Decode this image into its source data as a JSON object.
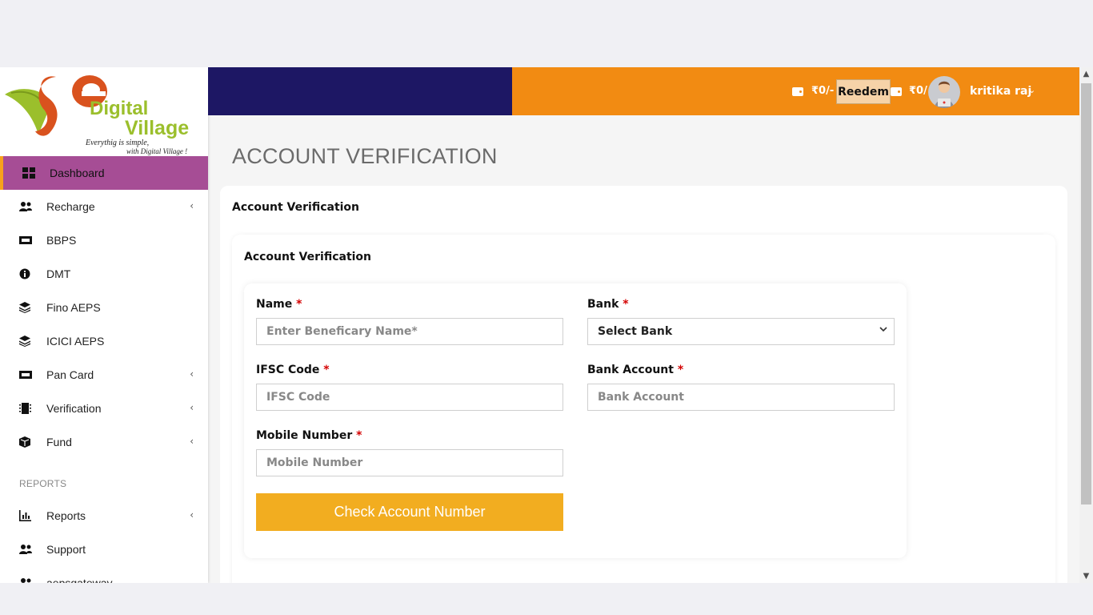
{
  "brand": {
    "logo_word_1": "Digital",
    "logo_word_2": "Village",
    "tagline_1": "Everythig is simple,",
    "tagline_2": "with Digital Village !",
    "colors": {
      "green": "#9bbf2c",
      "orange_red": "#d9521e"
    }
  },
  "sidebar": {
    "items": [
      {
        "label": "Dashboard",
        "icon": "dashboard-grid-icon",
        "active": true
      },
      {
        "label": "Recharge",
        "icon": "users-icon",
        "has_submenu": true
      },
      {
        "label": "BBPS",
        "icon": "ticket-icon"
      },
      {
        "label": "DMT",
        "icon": "info-circle-icon"
      },
      {
        "label": "Fino AEPS",
        "icon": "layers-icon"
      },
      {
        "label": "ICICI AEPS",
        "icon": "layers-icon"
      },
      {
        "label": "Pan Card",
        "icon": "ticket-icon",
        "has_submenu": true
      },
      {
        "label": "Verification",
        "icon": "chip-icon",
        "has_submenu": true
      },
      {
        "label": "Fund",
        "icon": "box-icon",
        "has_submenu": true
      }
    ],
    "section_heading": "REPORTS",
    "report_items": [
      {
        "label": "Reports",
        "icon": "bar-chart-icon",
        "has_submenu": true
      },
      {
        "label": "Support",
        "icon": "users-icon"
      },
      {
        "label": "aepsgateway",
        "icon": "users-icon"
      }
    ],
    "chevron": "‹",
    "colors": {
      "active_bg": "#a64d95",
      "active_border": "#f7a21b"
    }
  },
  "header": {
    "wallet_1": "₹0/-",
    "reedem_label": "Reedem",
    "wallet_2": "₹0/",
    "username": "kritika raj",
    "user_chevron": "⌄",
    "colors": {
      "dark": "#1d1764",
      "orange": "#f28b12"
    }
  },
  "page": {
    "title": "ACCOUNT VERIFICATION",
    "outer_card_title": "Account Verification",
    "inner_card_title": "Account Verification"
  },
  "form": {
    "name": {
      "label": "Name",
      "placeholder": "Enter Beneficary Name*"
    },
    "bank": {
      "label": "Bank",
      "selected": "Select Bank"
    },
    "ifsc": {
      "label": "IFSC Code",
      "placeholder": "IFSC Code"
    },
    "bank_account": {
      "label": "Bank Account",
      "placeholder": "Bank Account"
    },
    "mobile": {
      "label": "Mobile Number",
      "placeholder": "Mobile Number"
    },
    "required_mark": "*",
    "submit_label": "Check Account Number",
    "colors": {
      "submit_bg": "#f2ad20",
      "required": "#d40000"
    }
  },
  "scrollbar": {
    "up": "▲",
    "down": "▼"
  }
}
